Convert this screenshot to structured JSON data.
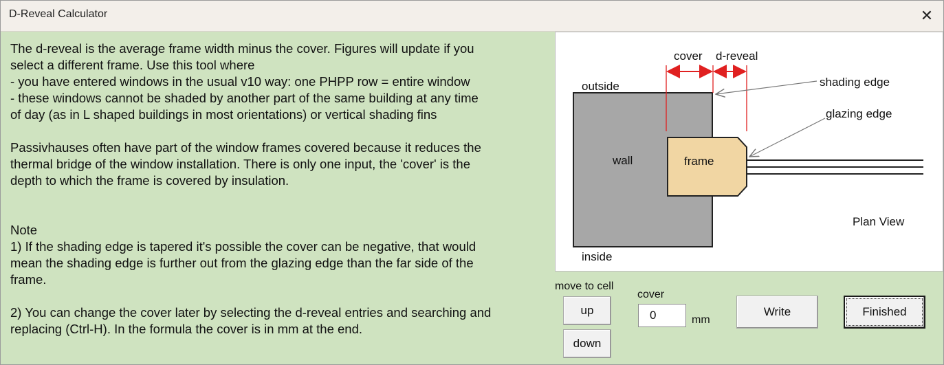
{
  "window": {
    "title": "D-Reveal Calculator"
  },
  "description": {
    "para1": "The d-reveal is the average frame width minus the cover. Figures will update if you\nselect a different frame. Use this tool where\n - you have entered windows in the usual v10 way: one PHPP row = entire window\n - these windows cannot be shaded by another part of the same building at any time\nof day (as in L shaped buildings in most orientations) or vertical shading fins",
    "para2": "Passivhauses often have part of the window frames covered because it reduces the\nthermal bridge of the window installation. There is only one input, the 'cover' is the\ndepth to which the frame is covered by insulation.",
    "note_heading": "Note",
    "note1": "1) If the shading edge is tapered it's possible the cover can be negative, that would\nmean the shading edge is further out from the glazing edge than the far side of the\nframe.",
    "note2": "2) You can change the cover later by selecting the d-reveal entries and searching and\nreplacing (Ctrl-H). In the formula the cover is in mm at the end."
  },
  "diagram": {
    "labels": {
      "cover": "cover",
      "d_reveal": "d-reveal",
      "outside": "outside",
      "inside": "inside",
      "wall": "wall",
      "frame": "frame",
      "shading_edge": "shading edge",
      "glazing_edge": "glazing edge",
      "plan_view": "Plan View"
    },
    "colors": {
      "wall": "#a7a7a7",
      "frame": "#f1d6a3",
      "dimension": "#e02020"
    }
  },
  "controls": {
    "move_label": "move to cell",
    "up_label": "up",
    "down_label": "down",
    "cover_label": "cover",
    "cover_value": "0",
    "unit": "mm",
    "write_label": "Write",
    "finished_label": "Finished"
  },
  "icons": {
    "close": "close-icon"
  }
}
